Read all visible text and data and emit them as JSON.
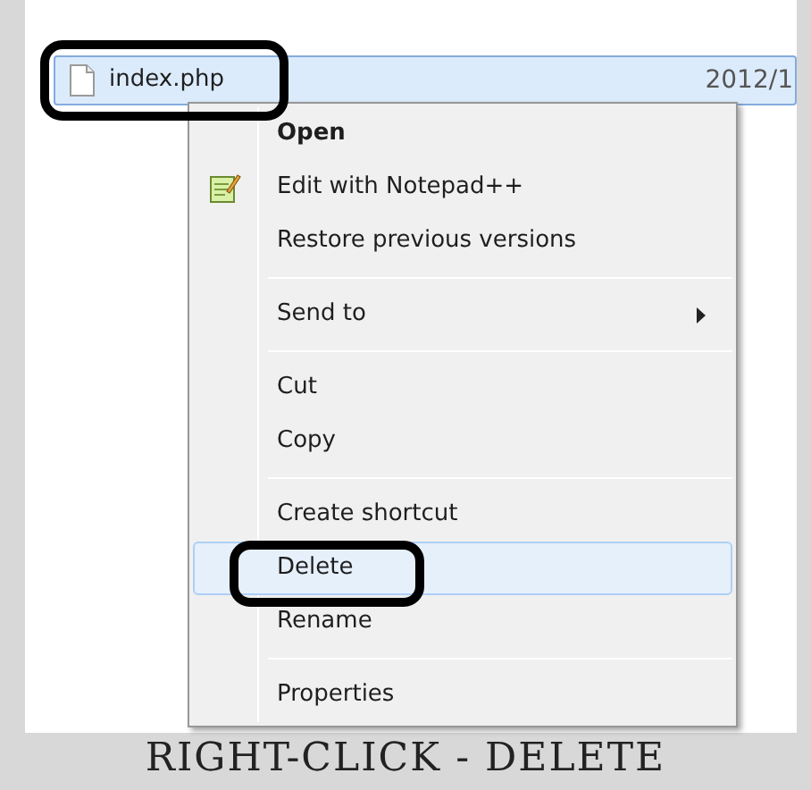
{
  "file_row": {
    "name": "index.php",
    "date": "2012/1",
    "selected": true
  },
  "context_menu": {
    "groups": [
      {
        "items": [
          {
            "label": "Open",
            "bold": true,
            "has_icon": false,
            "submenu": false,
            "selected": false
          },
          {
            "label": "Edit with Notepad++",
            "bold": false,
            "has_icon": true,
            "submenu": false,
            "selected": false
          },
          {
            "label": "Restore previous versions",
            "bold": false,
            "has_icon": false,
            "submenu": false,
            "selected": false
          }
        ]
      },
      {
        "items": [
          {
            "label": "Send to",
            "bold": false,
            "has_icon": false,
            "submenu": true,
            "selected": false
          }
        ]
      },
      {
        "items": [
          {
            "label": "Cut",
            "bold": false,
            "has_icon": false,
            "submenu": false,
            "selected": false
          },
          {
            "label": "Copy",
            "bold": false,
            "has_icon": false,
            "submenu": false,
            "selected": false
          }
        ]
      },
      {
        "items": [
          {
            "label": "Create shortcut",
            "bold": false,
            "has_icon": false,
            "submenu": false,
            "selected": false
          },
          {
            "label": "Delete",
            "bold": false,
            "has_icon": false,
            "submenu": false,
            "selected": true
          },
          {
            "label": "Rename",
            "bold": false,
            "has_icon": false,
            "submenu": false,
            "selected": false
          }
        ]
      },
      {
        "items": [
          {
            "label": "Properties",
            "bold": false,
            "has_icon": false,
            "submenu": false,
            "selected": false
          }
        ]
      }
    ]
  },
  "caption": "RIGHT-CLICK - DELETE"
}
